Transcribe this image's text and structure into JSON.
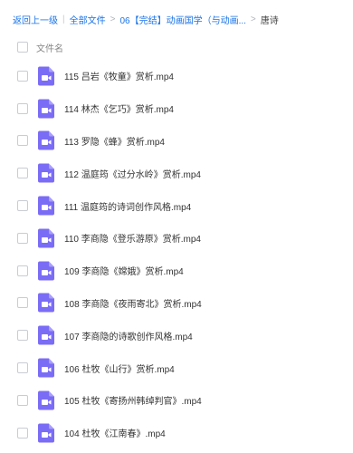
{
  "breadcrumb": {
    "back": "返回上一级",
    "all_files": "全部文件",
    "folder": "06【完结】动画国学（与动画...",
    "current": "唐诗"
  },
  "table": {
    "column_name": "文件名"
  },
  "icon_color": "#7b6cf6",
  "files": [
    "115 吕岩《牧童》赏析.mp4",
    "114 林杰《乞巧》赏析.mp4",
    "113 罗隐《蜂》赏析.mp4",
    "112 温庭筠《过分水岭》赏析.mp4",
    "111 温庭筠的诗词创作风格.mp4",
    "110 李商隐《登乐游原》赏析.mp4",
    "109 李商隐《嫦娥》赏析.mp4",
    "108 李商隐《夜雨寄北》赏析.mp4",
    "107 李商隐的诗歌创作风格.mp4",
    "106 杜牧《山行》赏析.mp4",
    "105 杜牧《寄扬州韩绰判官》.mp4",
    "104 杜牧《江南春》.mp4"
  ]
}
